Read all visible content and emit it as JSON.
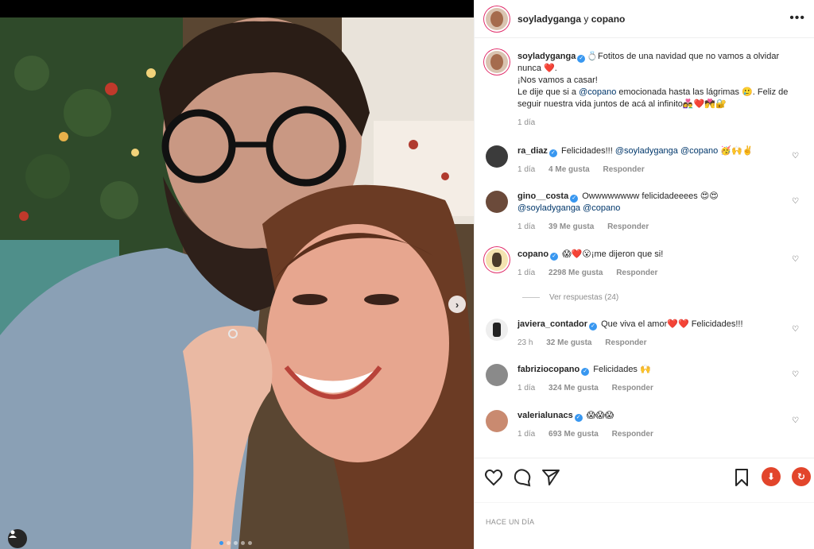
{
  "post": {
    "header_user": "soyladyganga",
    "header_joiner": " y ",
    "header_collab": "copano",
    "timestamp": "HACE UN DÍA"
  },
  "caption": {
    "username": "soyladyganga",
    "line1": "💍Fotitos de una navidad que no vamos a olvidar nunca ❤️.",
    "line2": "¡Nos vamos a casar!",
    "line3a": "Le dije que si a ",
    "line3_mention": "@copano",
    "line3b": " emocionada hasta las lágrimas 🥲. Feliz de seguir nuestra vida juntos de acá al infinito👩‍❤️‍👨❤️💏🔐",
    "time": "1 día"
  },
  "comments": [
    {
      "username": "ra_diaz",
      "text": "Felicidades!!! ",
      "mentions": "@soyladyganga @copano",
      "emoji": " 🥳🙌✌️",
      "time": "1 día",
      "likes": "4 Me gusta",
      "reply": "Responder"
    },
    {
      "username": "gino__costa",
      "text": "Owwwwwwww felicidadeeees 😍😍",
      "mentions": "@soyladyganga @copano",
      "emoji": "",
      "time": "1 día",
      "likes": "39 Me gusta",
      "reply": "Responder"
    },
    {
      "username": "copano",
      "text": "😱❤️😮¡me dijeron que si!",
      "mentions": "",
      "emoji": "",
      "time": "1 día",
      "likes": "2298 Me gusta",
      "reply": "Responder"
    },
    {
      "username": "javiera_contador",
      "text": "Que viva el amor❤️❤️ Felicidades!!!",
      "mentions": "",
      "emoji": "",
      "time": "23 h",
      "likes": "32 Me gusta",
      "reply": "Responder"
    },
    {
      "username": "fabriziocopano",
      "text": "Felicidades 🙌",
      "mentions": "",
      "emoji": "",
      "time": "1 día",
      "likes": "324 Me gusta",
      "reply": "Responder"
    },
    {
      "username": "valerialunacs",
      "text": "😱😱😱",
      "mentions": "",
      "emoji": "",
      "time": "1 día",
      "likes": "693 Me gusta",
      "reply": "Responder"
    }
  ],
  "replies_label": "Ver respuestas (24)",
  "icons": {
    "like": "heart-icon",
    "comment": "comment-icon",
    "share": "paper-plane-icon",
    "save": "bookmark-icon",
    "download": "download-icon",
    "refresh": "refresh-icon",
    "more": "more-icon",
    "next": "chevron-right-icon",
    "tag": "user-tag-icon"
  },
  "colors": {
    "accent": "#3897f0",
    "link": "#00376b",
    "muted": "#8e8e8e",
    "extension": "#e2452b"
  },
  "carousel": {
    "total_slides": 5,
    "active_slide": 1
  }
}
